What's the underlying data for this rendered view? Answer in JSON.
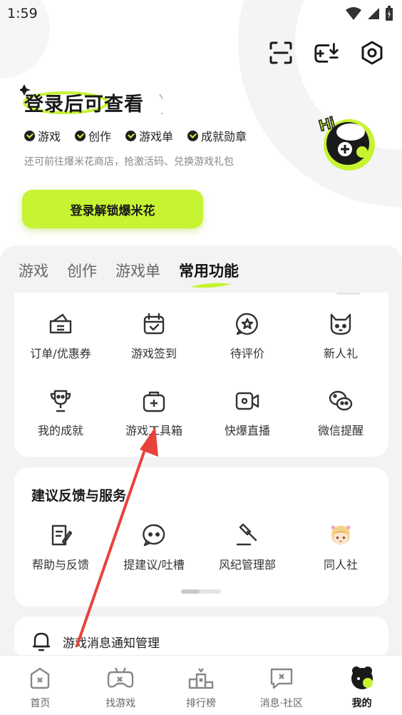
{
  "status_bar": {
    "time": "1:59"
  },
  "header": {
    "title": "登录后可查看",
    "perks": [
      "游戏",
      "创作",
      "游戏单",
      "成就勋章"
    ],
    "subtitle": "还可前往爆米花商店，抢激活码、兑换游戏礼包",
    "login_button": "登录解锁爆米花",
    "mascot_text": "Hi"
  },
  "tabs": [
    {
      "label": "游戏",
      "active": false
    },
    {
      "label": "创作",
      "active": false
    },
    {
      "label": "游戏单",
      "active": false
    },
    {
      "label": "常用功能",
      "active": true
    }
  ],
  "functions": [
    {
      "label": "订单/优惠券",
      "icon": "wallet-icon"
    },
    {
      "label": "游戏签到",
      "icon": "calendar-check-icon"
    },
    {
      "label": "待评价",
      "icon": "star-bubble-icon"
    },
    {
      "label": "新人礼",
      "icon": "cat-icon"
    },
    {
      "label": "我的成就",
      "icon": "trophy-icon"
    },
    {
      "label": "游戏工具箱",
      "icon": "toolbox-icon"
    },
    {
      "label": "快爆直播",
      "icon": "video-camera-icon"
    },
    {
      "label": "微信提醒",
      "icon": "wechat-icon"
    }
  ],
  "feedback": {
    "title": "建议反馈与服务",
    "items": [
      {
        "label": "帮助与反馈",
        "icon": "document-edit-icon"
      },
      {
        "label": "提建议/吐槽",
        "icon": "chat-bubble-icon"
      },
      {
        "label": "风纪管理部",
        "icon": "gavel-icon"
      },
      {
        "label": "同人社",
        "icon": "anime-girl-icon"
      }
    ]
  },
  "notify": {
    "label": "游戏消息通知管理"
  },
  "bottom_nav": [
    {
      "label": "首页",
      "icon": "home-icon",
      "active": false
    },
    {
      "label": "找游戏",
      "icon": "gamepad-icon",
      "active": false
    },
    {
      "label": "排行榜",
      "icon": "podium-icon",
      "active": false
    },
    {
      "label": "消息·社区",
      "icon": "message-icon",
      "active": false
    },
    {
      "label": "我的",
      "icon": "profile-mascot-icon",
      "active": true
    }
  ],
  "colors": {
    "accent": "#c6f432",
    "arrow": "#e8423c",
    "panel_bg": "#f3f3f5"
  }
}
